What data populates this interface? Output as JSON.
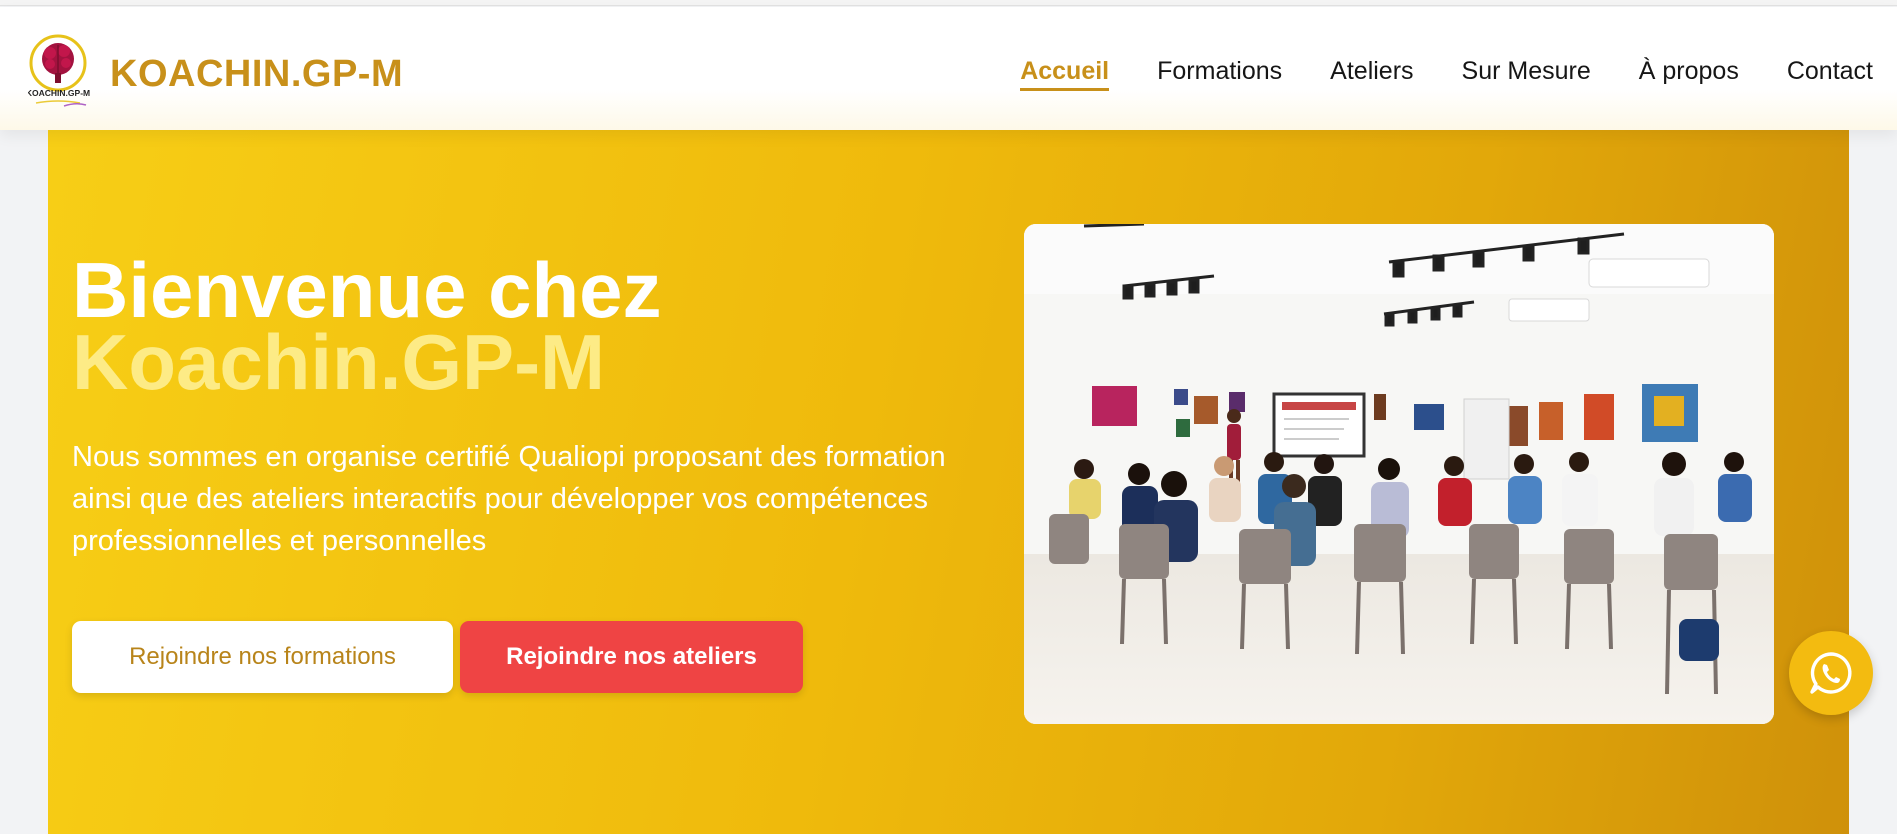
{
  "header": {
    "logo_text": "KOACHIN.GP-M",
    "brand": "KOACHIN.GP-M",
    "nav": [
      {
        "label": "Accueil",
        "active": true
      },
      {
        "label": "Formations",
        "active": false
      },
      {
        "label": "Ateliers",
        "active": false
      },
      {
        "label": "Sur Mesure",
        "active": false
      },
      {
        "label": "À propos",
        "active": false
      },
      {
        "label": "Contact",
        "active": false
      }
    ]
  },
  "hero": {
    "title_line1": "Bienvenue chez",
    "title_line2": "Koachin.GP-M",
    "description": "Nous sommes en organise certifié Qualiopi proposant des formation ainsi que des ateliers interactifs pour développer vos compétences professionnelles et personnelles",
    "btn_formations": "Rejoindre nos formations",
    "btn_ateliers": "Rejoindre nos ateliers",
    "image_subject": "workshop-audience-photo"
  },
  "floating": {
    "icon": "whatsapp-icon"
  },
  "colors": {
    "brand_gold": "#c8901a",
    "hero_yellow": "#f7ce16",
    "hero_title_accent": "#fdeb86",
    "cta_red": "#ef4444",
    "whatsapp_button": "#f3bb10"
  }
}
